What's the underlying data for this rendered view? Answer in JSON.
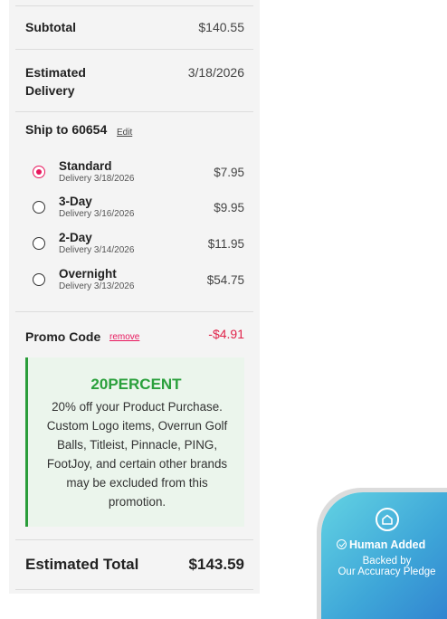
{
  "summary": {
    "subtotal_label": "Subtotal",
    "subtotal_value": "$140.55",
    "delivery_label_line1": "Estimated",
    "delivery_label_line2": "Delivery",
    "delivery_value": "3/18/2026"
  },
  "shipping": {
    "title": "Ship to 60654",
    "edit_label": "Edit",
    "selected": "Standard",
    "options": [
      {
        "name": "Standard",
        "delivery": "Delivery 3/18/2026",
        "price": "$7.95"
      },
      {
        "name": "3-Day",
        "delivery": "Delivery 3/16/2026",
        "price": "$9.95"
      },
      {
        "name": "2-Day",
        "delivery": "Delivery 3/14/2026",
        "price": "$11.95"
      },
      {
        "name": "Overnight",
        "delivery": "Delivery 3/13/2026",
        "price": "$54.75"
      }
    ]
  },
  "promo": {
    "label": "Promo Code",
    "remove_label": "remove",
    "amount": "-$4.91",
    "code": "20PERCENT",
    "description": "20% off your Product Purchase. Custom Logo items, Overrun Golf Balls, Titleist, Pinnacle, PING, FootJoy, and certain other brands may be excluded from this promotion."
  },
  "total": {
    "label": "Estimated Total",
    "value": "$143.59"
  },
  "badge": {
    "icon": "shield-home-icon",
    "title": "Human Added",
    "subtitle_line1": "Backed by",
    "subtitle_line2": "Our Accuracy Pledge"
  },
  "colors": {
    "accent": "#e8175d",
    "promo_green": "#2aa03c",
    "badge_blue": "#3ea6d8"
  }
}
